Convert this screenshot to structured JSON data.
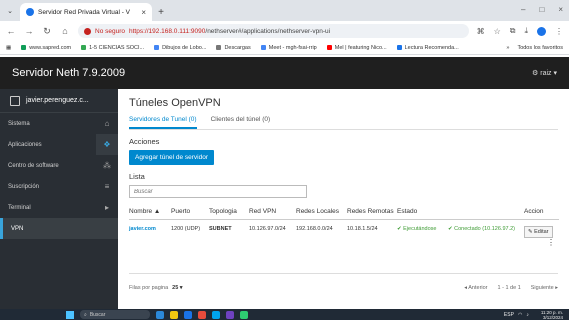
{
  "browser": {
    "tab_title": "Servidor Red Privada Virtual - V",
    "tab_close": "×",
    "new_tab": "+",
    "window_controls": [
      "–",
      "□",
      "×"
    ],
    "not_secure_label": "No seguro",
    "url_scheme_host": "https://192.168.0.111:9090",
    "url_path": "/nethserver#/applications/nethserver-vpn-ui",
    "bookmarks": [
      "www.sapred.com",
      "1-5 CIENCIAS SOCI...",
      "Dibujos de Lobo...",
      "Descargas",
      "Meet - mgh-fsai-rrip",
      "Mel | featuring Nico...",
      "Lectura Recomenda..."
    ],
    "bookmarks_more": "»",
    "all_bookmarks": "Todos los favoritos"
  },
  "app": {
    "title": "Servidor Neth 7.9.2009",
    "user_menu": "⚙ raiz ▾"
  },
  "sidebar": {
    "user": "javier.perenguez.c...",
    "items": [
      {
        "label": "Sistema",
        "icon": "⌂"
      },
      {
        "label": "Aplicaciones",
        "icon": "❖"
      },
      {
        "label": "Centro de software",
        "icon": "⁂"
      },
      {
        "label": "Suscripción",
        "icon": "≡"
      },
      {
        "label": "Terminal",
        "icon": "▸"
      },
      {
        "label": "VPN",
        "icon": ""
      }
    ]
  },
  "main": {
    "title": "Túneles OpenVPN",
    "tabs": [
      "Servidores de Tunel (0)",
      "Clientes del túnel (0)"
    ],
    "actions_label": "Acciones",
    "add_button": "Agregar túnel de servidor",
    "list_label": "Lista",
    "search_placeholder": "Buscar",
    "columns": [
      "Nombre ▲",
      "Puerto",
      "Topologia",
      "Red VPN",
      "Redes Locales",
      "Redes Remotas",
      "Estado",
      "",
      "Accion"
    ],
    "rows": [
      {
        "name": "javier.com",
        "port": "1200 (UDP)",
        "topology": "SUBNET",
        "vpn_net": "10.126.97.0/24",
        "local_nets": "192.168.0.0/24",
        "remote_nets": "10.18.1.5/24",
        "state": "✔ Ejecutándose",
        "connection": "✔ Conectado (10.126.97.2)",
        "edit": "✎ Editar"
      }
    ],
    "pager": {
      "rows_per_page_label": "Filas por pagina",
      "rows_per_page_value": "25 ▾",
      "prev": "◂ Anterior",
      "range": "1 - 1 de 1",
      "next": "Siguiente ▸"
    }
  },
  "taskbar": {
    "search": "Buscar",
    "lang": "ESP",
    "time": "11:20 p. m.",
    "date": "3/12/2024"
  }
}
